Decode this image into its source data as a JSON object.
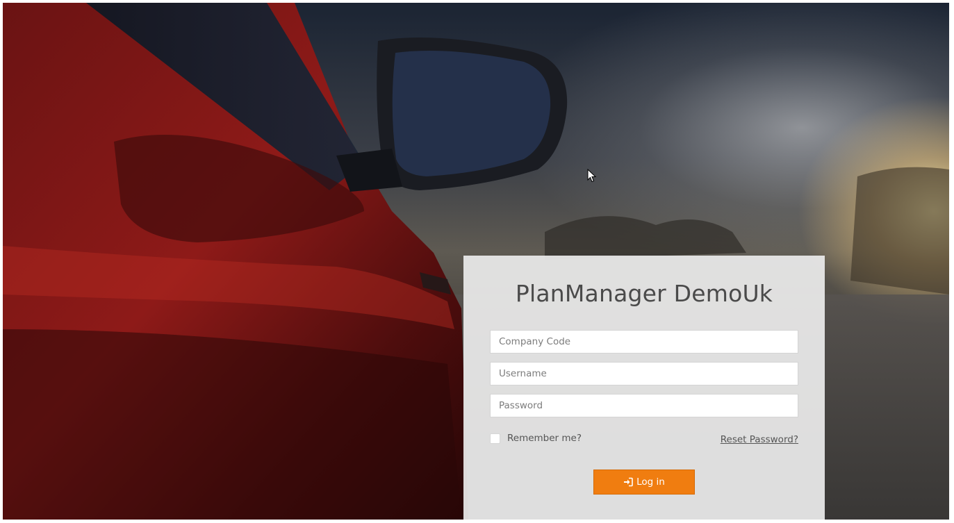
{
  "login": {
    "title": "PlanManager DemoUk",
    "company_code_placeholder": "Company Code",
    "username_placeholder": "Username",
    "password_placeholder": "Password",
    "remember_label": "Remember me?",
    "remember_checked": false,
    "reset_password_label": "Reset Password?",
    "login_button_label": "Log in",
    "login_button_icon": "sign-in-icon"
  },
  "colors": {
    "accent": "#f07d10",
    "card_background": "#ebebeb",
    "title_text": "#4a4a4a"
  },
  "background": {
    "image": "red-car-side-mirror-sunset-photo"
  }
}
